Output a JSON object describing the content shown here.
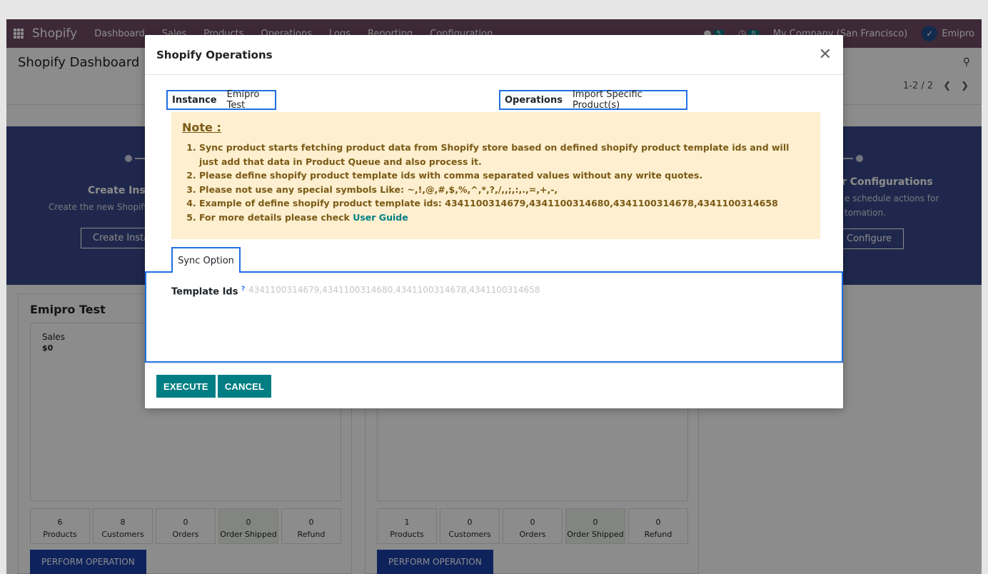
{
  "navbar": {
    "brand": "Shopify",
    "menu": [
      "Dashboard",
      "Sales",
      "Products",
      "Operations",
      "Logs",
      "Reporting",
      "Configuration"
    ],
    "messages_count": "5",
    "activities_count": "8",
    "company": "My Company (San Francisco)",
    "user": "Emipro"
  },
  "control_panel": {
    "title": "Shopify Dashboard",
    "pager": "1-2 / 2"
  },
  "banner": {
    "left_title": "Create Inst",
    "left_desc": "Create the new Shopify",
    "left_button": "Create Insta",
    "right_title": "r Configurations",
    "right_desc_1": "e schedule actions for",
    "right_desc_2": "tomation.",
    "right_button": "Configure"
  },
  "cards": [
    {
      "title": "Emipro Test",
      "graph_label": "Sales",
      "graph_value": "$0",
      "stats": [
        {
          "value": "6",
          "label": "Products"
        },
        {
          "value": "8",
          "label": "Customers"
        },
        {
          "value": "0",
          "label": "Orders"
        },
        {
          "value": "0",
          "label": "Order Shipped"
        },
        {
          "value": "0",
          "label": "Refund"
        }
      ],
      "button": "PERFORM OPERATION"
    },
    {
      "title": "",
      "stats": [
        {
          "value": "1",
          "label": "Products"
        },
        {
          "value": "0",
          "label": "Customers"
        },
        {
          "value": "0",
          "label": "Orders"
        },
        {
          "value": "0",
          "label": "Order Shipped"
        },
        {
          "value": "0",
          "label": "Refund"
        }
      ],
      "button": "PERFORM OPERATION"
    }
  ],
  "modal": {
    "title": "Shopify Operations",
    "instance_label": "Instance",
    "instance_value": "Emipro Test",
    "operations_label": "Operations",
    "operations_value": "Import Specific Product(s)",
    "note_title": "Note :",
    "note_items": [
      "Sync product starts fetching product data from Shopify store based on defined shopify product template ids and will just add that data in Product Queue and also process it.",
      "Please define shopify product template ids with comma separated values without any write quotes.",
      "Please not use any special symbols Like: ~,!,@,#,$,%,^,*,?,/,,;,:,.,=,+,-,",
      "Example of define shopify product template ids: 4341100314679,4341100314680,4341100314678,4341100314658"
    ],
    "note_last_prefix": "For more details please check ",
    "note_last_link": "User Guide",
    "tab_label": "Sync Option",
    "template_ids_label": "Template Ids",
    "template_ids_help": "?",
    "template_ids_placeholder": "4341100314679,4341100314680,4341100314678,4341100314658",
    "execute_label": "EXECUTE",
    "cancel_label": "CANCEL"
  }
}
